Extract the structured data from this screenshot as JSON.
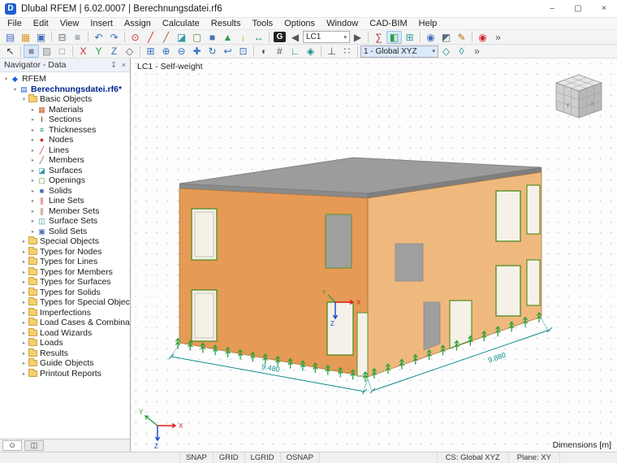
{
  "window": {
    "title": "Dlubal RFEM | 6.02.0007 | Berechnungsdatei.rf6",
    "minimize": "–",
    "maximize": "▢",
    "close": "×",
    "app_badge": "D"
  },
  "menu": {
    "items": [
      "File",
      "Edit",
      "View",
      "Insert",
      "Assign",
      "Calculate",
      "Results",
      "Tools",
      "Options",
      "Window",
      "CAD-BIM",
      "Help"
    ]
  },
  "toolbar_top": {
    "items": [
      {
        "kind": "icon",
        "name": "new-model-icon",
        "glyph": "▤",
        "color": "#3f6fc0"
      },
      {
        "kind": "icon",
        "name": "open-model-icon",
        "glyph": "▦",
        "color": "#d99a2b"
      },
      {
        "kind": "icon",
        "name": "save-icon",
        "glyph": "▣",
        "color": "#3f6fb5"
      },
      {
        "kind": "sep"
      },
      {
        "kind": "icon",
        "name": "print-icon",
        "glyph": "⊟",
        "color": "#5a6b7a"
      },
      {
        "kind": "icon",
        "name": "printout-report-icon",
        "glyph": "≡",
        "color": "#5a6b7a"
      },
      {
        "kind": "sep"
      },
      {
        "kind": "icon",
        "name": "undo-icon",
        "glyph": "↶",
        "color": "#2f6fc0"
      },
      {
        "kind": "icon",
        "name": "redo-icon",
        "glyph": "↷",
        "color": "#2f6fc0"
      },
      {
        "kind": "sep"
      },
      {
        "kind": "icon",
        "name": "new-node-icon",
        "glyph": "⊙",
        "color": "#d02b2b"
      },
      {
        "kind": "icon",
        "name": "new-line-icon",
        "glyph": "╱",
        "color": "#d02b2b"
      },
      {
        "kind": "icon",
        "name": "new-member-icon",
        "glyph": "╱",
        "color": "#9a5b2d"
      },
      {
        "kind": "icon",
        "name": "new-surface-icon",
        "glyph": "◪",
        "color": "#2e9aa0"
      },
      {
        "kind": "icon",
        "name": "new-opening-icon",
        "glyph": "▢",
        "color": "#5a8f29"
      },
      {
        "kind": "icon",
        "name": "new-solid-icon",
        "glyph": "■",
        "color": "#4a6fb5"
      },
      {
        "kind": "icon",
        "name": "new-support-icon",
        "glyph": "▲",
        "color": "#2f9e44"
      },
      {
        "kind": "icon",
        "name": "new-load-icon",
        "glyph": "↓",
        "color": "#d9a520"
      },
      {
        "kind": "icon",
        "name": "dimension-icon",
        "glyph": "↔",
        "color": "#0d8a8a"
      },
      {
        "kind": "sep"
      },
      {
        "kind": "icon",
        "name": "load-case-generator-icon",
        "glyph": "G",
        "color": "#ffffff",
        "bg": "#222222"
      },
      {
        "kind": "icon",
        "name": "previous-load-case-icon",
        "glyph": "◀",
        "color": "#555555"
      },
      {
        "kind": "combo",
        "name": "load-case-selector",
        "value": "LC1",
        "width": 58
      },
      {
        "kind": "icon",
        "name": "next-load-case-icon",
        "glyph": "▶",
        "color": "#555555"
      },
      {
        "kind": "sep"
      },
      {
        "kind": "icon",
        "name": "calculate-icon",
        "glyph": "∑",
        "color": "#b03030"
      },
      {
        "kind": "icon",
        "name": "show-results-icon",
        "glyph": "◧",
        "color": "#2f9e44",
        "active": true
      },
      {
        "kind": "icon",
        "name": "result-tables-icon",
        "glyph": "⊞",
        "color": "#2e9aa0"
      },
      {
        "kind": "sep"
      },
      {
        "kind": "icon",
        "name": "visibility-icon",
        "glyph": "◉",
        "color": "#3f6fc0"
      },
      {
        "kind": "icon",
        "name": "section-view-icon",
        "glyph": "◩",
        "color": "#5a6b7a"
      },
      {
        "kind": "icon",
        "name": "annotation-icon",
        "glyph": "✎",
        "color": "#b06a10"
      },
      {
        "kind": "sep"
      },
      {
        "kind": "icon",
        "name": "rfem-logo-icon",
        "glyph": "◉",
        "color": "#d02b2b"
      },
      {
        "kind": "icon",
        "name": "toolbar-overflow-icon",
        "glyph": "»",
        "color": "#555555"
      }
    ]
  },
  "toolbar_view": {
    "items": [
      {
        "kind": "icon",
        "name": "select-cursor-icon",
        "glyph": "↖",
        "color": "#333333"
      },
      {
        "kind": "sep"
      },
      {
        "kind": "icon",
        "name": "render-solid-icon",
        "glyph": "■",
        "color": "#8a8f94",
        "active": true
      },
      {
        "kind": "icon",
        "name": "render-transparent-icon",
        "glyph": "▨",
        "color": "#8a8f94"
      },
      {
        "kind": "icon",
        "name": "render-wireframe-icon",
        "glyph": "□",
        "color": "#8a8f94"
      },
      {
        "kind": "sep"
      },
      {
        "kind": "icon",
        "name": "view-x-icon",
        "glyph": "X",
        "color": "#d02b2b"
      },
      {
        "kind": "icon",
        "name": "view-y-icon",
        "glyph": "Y",
        "color": "#2f9e44"
      },
      {
        "kind": "icon",
        "name": "view-z-icon",
        "glyph": "Z",
        "color": "#2f6fc0"
      },
      {
        "kind": "icon",
        "name": "isometric-view-icon",
        "glyph": "◇",
        "color": "#555555"
      },
      {
        "kind": "sep"
      },
      {
        "kind": "icon",
        "name": "zoom-window-icon",
        "glyph": "⊞",
        "color": "#2f6fc0"
      },
      {
        "kind": "icon",
        "name": "zoom-in-icon",
        "glyph": "⊕",
        "color": "#2f6fc0"
      },
      {
        "kind": "icon",
        "name": "zoom-out-icon",
        "glyph": "⊖",
        "color": "#2f6fc0"
      },
      {
        "kind": "icon",
        "name": "pan-icon",
        "glyph": "✚",
        "color": "#2f6fc0"
      },
      {
        "kind": "icon",
        "name": "rotate-view-icon",
        "glyph": "↻",
        "color": "#2f6fc0"
      },
      {
        "kind": "icon",
        "name": "previous-view-icon",
        "glyph": "↩",
        "color": "#2f6fc0"
      },
      {
        "kind": "icon",
        "name": "show-all-icon",
        "glyph": "⊡",
        "color": "#2f6fc0"
      },
      {
        "kind": "sep"
      },
      {
        "kind": "icon",
        "name": "display-properties-icon",
        "glyph": "◐",
        "color": "#555555"
      },
      {
        "kind": "icon",
        "name": "numbering-icon",
        "glyph": "#",
        "color": "#555555"
      },
      {
        "kind": "icon",
        "name": "guide-lines-icon",
        "glyph": "∟",
        "color": "#0d8a8a"
      },
      {
        "kind": "icon",
        "name": "snap-settings-icon",
        "glyph": "◈",
        "color": "#0d8a8a"
      },
      {
        "kind": "sep"
      },
      {
        "kind": "icon",
        "name": "axes-toggle-icon",
        "glyph": "⊥",
        "color": "#555555"
      },
      {
        "kind": "icon",
        "name": "grid-toggle-icon",
        "glyph": "∷",
        "color": "#555555"
      },
      {
        "kind": "sep"
      },
      {
        "kind": "combo",
        "name": "coordinate-system-selector",
        "value": "1 - Global XYZ",
        "width": 96,
        "accent": true
      },
      {
        "kind": "icon",
        "name": "work-plane-icon",
        "glyph": "◇",
        "color": "#0d8a8a"
      },
      {
        "kind": "icon",
        "name": "plane-grid-icon",
        "glyph": "◊",
        "color": "#0d8a8a"
      },
      {
        "kind": "icon",
        "name": "toolbar-overflow-2-icon",
        "glyph": "»",
        "color": "#555555"
      }
    ]
  },
  "navigator": {
    "title": "Navigator - Data",
    "tabs": [
      {
        "name": "navigator-tab-data",
        "glyph": "⊙",
        "active": true
      },
      {
        "name": "navigator-tab-views",
        "glyph": "◫",
        "active": false
      }
    ],
    "tree": [
      {
        "label": "RFEM",
        "depth": 0,
        "chevron": "expanded",
        "icon": "rfem-logo",
        "glyph": "◆",
        "color": "#1f5fd0"
      },
      {
        "label": "Berechnungsdatei.rf6*",
        "depth": 1,
        "chevron": "expanded",
        "icon": "model-file",
        "glyph": "▤",
        "color": "#1f5fd0",
        "bold": true,
        "text_color": "#00258f"
      },
      {
        "label": "Basic Objects",
        "depth": 2,
        "chevron": "expanded",
        "icon": "folder"
      },
      {
        "label": "Materials",
        "depth": 3,
        "chevron": "collapsed",
        "icon": "materials",
        "glyph": "▦",
        "color": "#c75b2a"
      },
      {
        "label": "Sections",
        "depth": 3,
        "chevron": "collapsed",
        "icon": "sections",
        "glyph": "Ⅰ",
        "color": "#8b2500"
      },
      {
        "label": "Thicknesses",
        "depth": 3,
        "chevron": "collapsed",
        "icon": "thicknesses",
        "glyph": "≡",
        "color": "#0e8c8c"
      },
      {
        "label": "Nodes",
        "depth": 3,
        "chevron": "collapsed",
        "icon": "nodes",
        "glyph": "●",
        "color": "#d22b2b"
      },
      {
        "label": "Lines",
        "depth": 3,
        "chevron": "collapsed",
        "icon": "lines",
        "glyph": "╱",
        "color": "#d22b2b"
      },
      {
        "label": "Members",
        "depth": 3,
        "chevron": "collapsed",
        "icon": "members",
        "glyph": "╱",
        "color": "#9a5b2d"
      },
      {
        "label": "Surfaces",
        "depth": 3,
        "chevron": "collapsed",
        "icon": "surfaces",
        "glyph": "◪",
        "color": "#2e9aa0"
      },
      {
        "label": "Openings",
        "depth": 3,
        "chevron": "collapsed",
        "icon": "openings",
        "glyph": "▢",
        "color": "#5a8f29"
      },
      {
        "label": "Solids",
        "depth": 3,
        "chevron": "collapsed",
        "icon": "solids",
        "glyph": "■",
        "color": "#4a6fb5"
      },
      {
        "label": "Line Sets",
        "depth": 3,
        "chevron": "collapsed",
        "icon": "line-sets",
        "glyph": "∥",
        "color": "#d22b2b"
      },
      {
        "label": "Member Sets",
        "depth": 3,
        "chevron": "collapsed",
        "icon": "member-sets",
        "glyph": "∥",
        "color": "#9a5b2d"
      },
      {
        "label": "Surface Sets",
        "depth": 3,
        "chevron": "collapsed",
        "icon": "surface-sets",
        "glyph": "◫",
        "color": "#2e9aa0"
      },
      {
        "label": "Solid Sets",
        "depth": 3,
        "chevron": "collapsed",
        "icon": "solid-sets",
        "glyph": "▣",
        "color": "#4a6fb5"
      },
      {
        "label": "Special Objects",
        "depth": 2,
        "chevron": "collapsed",
        "icon": "folder"
      },
      {
        "label": "Types for Nodes",
        "depth": 2,
        "chevron": "collapsed",
        "icon": "folder"
      },
      {
        "label": "Types for Lines",
        "depth": 2,
        "chevron": "collapsed",
        "icon": "folder"
      },
      {
        "label": "Types for Members",
        "depth": 2,
        "chevron": "collapsed",
        "icon": "folder"
      },
      {
        "label": "Types for Surfaces",
        "depth": 2,
        "chevron": "collapsed",
        "icon": "folder"
      },
      {
        "label": "Types for Solids",
        "depth": 2,
        "chevron": "collapsed",
        "icon": "folder"
      },
      {
        "label": "Types for Special Objects",
        "depth": 2,
        "chevron": "collapsed",
        "icon": "folder"
      },
      {
        "label": "Imperfections",
        "depth": 2,
        "chevron": "collapsed",
        "icon": "folder"
      },
      {
        "label": "Load Cases & Combinations",
        "depth": 2,
        "chevron": "collapsed",
        "icon": "folder"
      },
      {
        "label": "Load Wizards",
        "depth": 2,
        "chevron": "collapsed",
        "icon": "folder"
      },
      {
        "label": "Loads",
        "depth": 2,
        "chevron": "collapsed",
        "icon": "folder"
      },
      {
        "label": "Results",
        "depth": 2,
        "chevron": "collapsed",
        "icon": "folder"
      },
      {
        "label": "Guide Objects",
        "depth": 2,
        "chevron": "collapsed",
        "icon": "folder"
      },
      {
        "label": "Printout Reports",
        "depth": 2,
        "chevron": "collapsed",
        "icon": "folder"
      }
    ]
  },
  "viewport": {
    "load_case_label": "LC1 - Self-weight",
    "dimensions_label": "Dimensions [m]",
    "dim_front": "9.480",
    "dim_side": "9.880",
    "axis_x": "X",
    "axis_y": "Y",
    "axis_z": "Z"
  },
  "statusbar": {
    "toggles": [
      "SNAP",
      "GRID",
      "LGRID",
      "OSNAP"
    ],
    "cs": "CS: Global XYZ",
    "plane": "Plane: XY"
  },
  "colors": {
    "wall_front": "#E59A55",
    "wall_side": "#EFB97E",
    "roof": "#9C9C9C",
    "roof_edge_front": "#8A8A8A",
    "roof_edge_right": "#7F7F7F",
    "wall_outline": "#A87840",
    "support_green": "#2DA23C",
    "dimension_teal": "#0D8C8C",
    "window_fill": "#F5F1E8",
    "window_frame": "#5A8F29",
    "opening_gray": "#9F9F9F"
  }
}
